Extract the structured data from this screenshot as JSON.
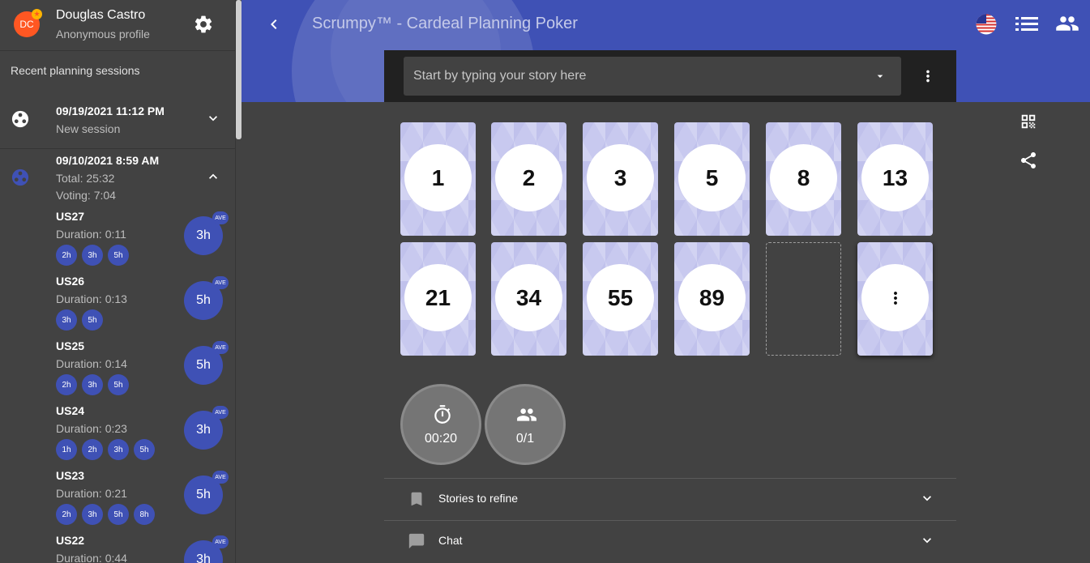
{
  "user": {
    "initials": "DC",
    "name": "Douglas Castro",
    "profile_type": "Anonymous profile"
  },
  "sidebar": {
    "recent_title": "Recent planning sessions",
    "sessions": [
      {
        "date": "09/19/2021 11:12 PM",
        "subtitle": "New session",
        "expanded": false
      },
      {
        "date": "09/10/2021 8:59 AM",
        "total": "Total: 25:32",
        "voting": "Voting: 7:04",
        "expanded": true
      }
    ],
    "stories": [
      {
        "name": "US27",
        "duration": "Duration: 0:11",
        "votes": [
          "2h",
          "3h",
          "5h"
        ],
        "average": "3h"
      },
      {
        "name": "US26",
        "duration": "Duration: 0:13",
        "votes": [
          "3h",
          "5h"
        ],
        "average": "5h"
      },
      {
        "name": "US25",
        "duration": "Duration: 0:14",
        "votes": [
          "2h",
          "3h",
          "5h"
        ],
        "average": "5h"
      },
      {
        "name": "US24",
        "duration": "Duration: 0:23",
        "votes": [
          "1h",
          "2h",
          "3h",
          "5h"
        ],
        "average": "3h"
      },
      {
        "name": "US23",
        "duration": "Duration: 0:21",
        "votes": [
          "2h",
          "3h",
          "5h",
          "8h"
        ],
        "average": "5h"
      },
      {
        "name": "US22",
        "duration": "Duration: 0:44",
        "votes": [],
        "average": "3h"
      }
    ],
    "ave_badge": "AVE"
  },
  "header": {
    "title": "Scrumpy™ - Cardeal Planning Poker"
  },
  "story_input": {
    "placeholder": "Start by typing your story here"
  },
  "cards": [
    "1",
    "2",
    "3",
    "5",
    "8",
    "13",
    "21",
    "34",
    "55",
    "89"
  ],
  "stats": {
    "timer": "00:20",
    "voters": "0/1"
  },
  "panels": {
    "stories_label": "Stories to refine",
    "chat_label": "Chat"
  },
  "colors": {
    "primary": "#3f51b5",
    "background": "#424242",
    "avatar": "#ff5722"
  }
}
